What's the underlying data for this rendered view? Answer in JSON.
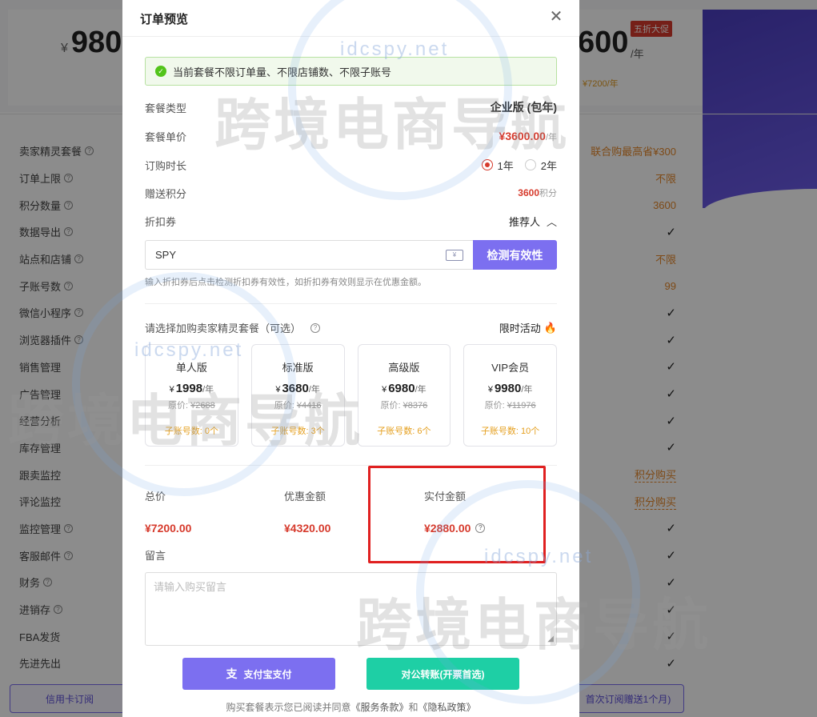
{
  "background": {
    "left_price_currency": "¥",
    "left_price": "980",
    "right_price": "600",
    "per_year": "/年",
    "promo_badge": "五折大促",
    "right_orig_price": "¥7200/年",
    "features": [
      "卖家精灵套餐",
      "订单上限",
      "积分数量",
      "数据导出",
      "站点和店铺",
      "子账号数",
      "微信小程序",
      "浏览器插件",
      "销售管理",
      "广告管理",
      "经营分析",
      "库存管理",
      "跟卖监控",
      "评论监控",
      "监控管理",
      "客服邮件",
      "财务",
      "进销存",
      "FBA发货",
      "先进先出"
    ],
    "feature_help": [
      true,
      true,
      true,
      true,
      true,
      true,
      true,
      true,
      false,
      false,
      false,
      false,
      false,
      false,
      true,
      true,
      true,
      true,
      false,
      false
    ],
    "values": [
      "联合购最高省¥300",
      "不限",
      "3600",
      "✓",
      "不限",
      "99",
      "✓",
      "✓",
      "✓",
      "✓",
      "✓",
      "✓",
      "积分购买",
      "积分购买",
      "✓",
      "✓",
      "✓",
      "✓",
      "✓",
      "✓"
    ],
    "left_button": "信用卡订阅",
    "right_button": "首次订阅赠送1个月)"
  },
  "modal": {
    "title": "订单预览",
    "close_icon": "close-icon",
    "notice": "当前套餐不限订单量、不限店铺数、不限子账号",
    "plan_type_label": "套餐类型",
    "plan_type_value": "企业版 (包年)",
    "unit_price_label": "套餐单价",
    "unit_price_value": "¥3600.00",
    "unit_price_unit": "/年",
    "duration_label": "订购时长",
    "duration_options": [
      "1年",
      "2年"
    ],
    "duration_selected": "1年",
    "bonus_points_label": "赠送积分",
    "bonus_points_value": "3600",
    "bonus_points_unit": "积分",
    "coupon_label": "折扣券",
    "recommender_label": "推荐人",
    "coupon_value": "SPY",
    "coupon_icon_text": "¥",
    "check_button": "检测有效性",
    "coupon_hint": "输入折扣券后点击检测折扣券有效性，如折扣券有效则显示在优惠金额。",
    "addon_title": "请选择加购卖家精灵套餐（可选）",
    "limited_label": "限时活动",
    "plans": [
      {
        "name": "单人版",
        "currency": "¥",
        "price": "1998",
        "unit": "/年",
        "orig_label": "原价: ",
        "orig": "¥2688",
        "sub": "子账号数: 0个"
      },
      {
        "name": "标准版",
        "currency": "¥",
        "price": "3680",
        "unit": "/年",
        "orig_label": "原价: ",
        "orig": "¥4416",
        "sub": "子账号数: 3个"
      },
      {
        "name": "高级版",
        "currency": "¥",
        "price": "6980",
        "unit": "/年",
        "orig_label": "原价: ",
        "orig": "¥8376",
        "sub": "子账号数: 6个"
      },
      {
        "name": "VIP会员",
        "currency": "¥",
        "price": "9980",
        "unit": "/年",
        "orig_label": "原价: ",
        "orig": "¥11976",
        "sub": "子账号数: 10个"
      }
    ],
    "total_label": "总价",
    "total_value": "¥7200.00",
    "discount_label": "优惠金额",
    "discount_value": "¥4320.00",
    "paid_label": "实付金额",
    "paid_value": "¥2880.00",
    "message_label": "留言",
    "message_placeholder": "请输入购买留言",
    "alipay_button": "支付宝支付",
    "transfer_button": "对公转账(开票首选)",
    "agreement_prefix": "购买套餐表示您已阅读并同意",
    "terms_link": "《服务条款》",
    "agreement_and": "和",
    "privacy_link": "《隐私政策》"
  },
  "watermark": {
    "domain": "idcspy.net",
    "brand": "跨境电商导航"
  },
  "colors": {
    "accent_purple": "#7c6ff0",
    "price_red": "#d63a2c",
    "success_green": "#52c41a",
    "transfer_green": "#1ecfa5",
    "highlight_red": "#e02020"
  }
}
